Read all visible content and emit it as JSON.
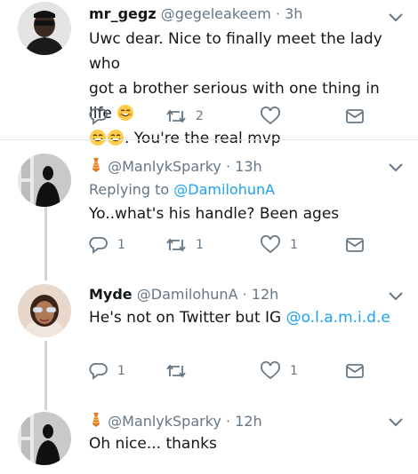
{
  "tweets": [
    {
      "name": "mr_gegz",
      "handle": "@gegeleakeem",
      "time": "3h",
      "text_line1": "Uwc dear. Nice to finally meet the lady who",
      "text_line2": "got a brother serious with one thing in life",
      "text_line3": ". You're the real mvp",
      "replies": "",
      "retweets": "2",
      "likes": ""
    },
    {
      "name": "",
      "handle": "@ManlykSparky",
      "time": "13h",
      "replying_label": "Replying to",
      "replying_to": "@DamilohunA",
      "text": "Yo..what's his handle? Been ages",
      "replies": "1",
      "retweets": "1",
      "likes": "1"
    },
    {
      "name": "Myde",
      "handle": "@DamilohunA",
      "time": "12h",
      "text_before": "He's not on Twitter but IG ",
      "text_link": "@o.l.a.m.i.d.e",
      "replies": "1",
      "retweets": "",
      "likes": "1"
    },
    {
      "name": "",
      "handle": "@ManlykSparky",
      "time": "12h",
      "text": "Oh nice... thanks"
    }
  ],
  "icons": [
    "reply-icon",
    "retweet-icon",
    "like-icon",
    "dm-icon",
    "chevron-down-icon",
    "tie-icon",
    "smiling-face-emoji"
  ],
  "colors": {
    "accent": "#1da1f2",
    "muted": "#657786",
    "separator": "#e1e8ed",
    "emoji": "#ffcc4d"
  }
}
